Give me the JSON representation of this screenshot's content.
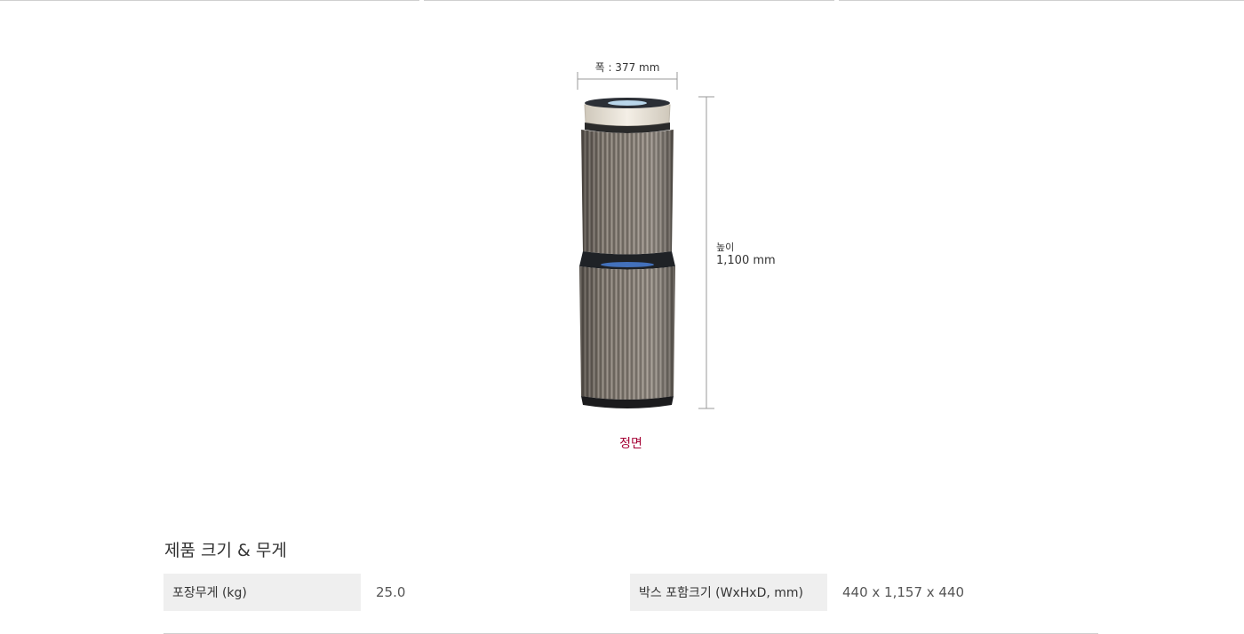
{
  "figure": {
    "width_label": "폭 : 377 mm",
    "height_label": "높이",
    "height_value": "1,100 mm",
    "view_caption": "정면",
    "caption_color": "#a50034",
    "product_image": "air-purifier-front-view"
  },
  "spec": {
    "section_title": "제품 크기 & 무게",
    "rows": [
      {
        "label": "포장무게 (kg)",
        "value": "25.0"
      },
      {
        "label": "박스 포함크기 (WxHxD, mm)",
        "value": "440 x 1,157 x 440"
      }
    ]
  }
}
